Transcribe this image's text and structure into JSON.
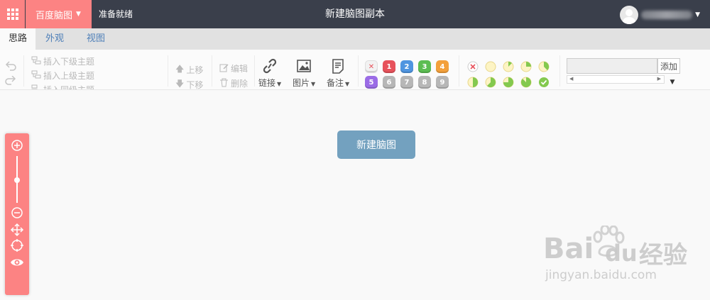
{
  "topbar": {
    "brand_label": "百度脑图",
    "status_text": "准备就绪",
    "document_title": "新建脑图副本"
  },
  "tabs": [
    {
      "label": "思路",
      "active": true
    },
    {
      "label": "外观",
      "active": false
    },
    {
      "label": "视图",
      "active": false
    }
  ],
  "ribbon": {
    "insert_child": "插入下级主题",
    "insert_parent": "插入上级主题",
    "insert_sibling": "插入同级主题",
    "move_up": "上移",
    "move_down": "下移",
    "edit": "编辑",
    "delete": "删除",
    "link": "链接",
    "image": "图片",
    "note": "备注",
    "priority_row1": [
      "✕",
      "1",
      "2",
      "3",
      "4"
    ],
    "priority_row2": [
      "5",
      "6",
      "7",
      "8",
      "9"
    ],
    "resource_add": "添加"
  },
  "canvas": {
    "root_node": "新建脑图"
  },
  "watermark": {
    "brand": "Bai",
    "brand2": "du",
    "site_cn": "经验",
    "site_url": "jingyan.baidu.com"
  },
  "colors": {
    "accent": "#fc8383",
    "topbar": "#3a3f4b",
    "root_node": "#73a1bf",
    "priority": [
      "#f2f2f2",
      "#e7525b",
      "#4f95e0",
      "#5cbd52",
      "#f3a03b",
      "#9b6ce6",
      "#b7b7b7",
      "#b7b7b7",
      "#b7b7b7",
      "#b7b7b7"
    ]
  }
}
